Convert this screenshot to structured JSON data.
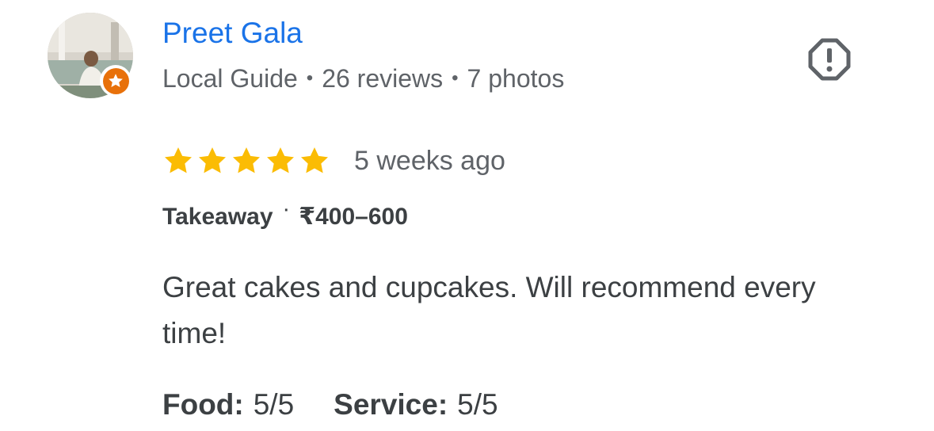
{
  "reviewer": {
    "name": "Preet Gala",
    "level": "Local Guide",
    "reviews": "26 reviews",
    "photos": "7 photos",
    "separator": "•"
  },
  "rating": {
    "stars": 5,
    "max_stars": 5,
    "time": "5 weeks ago",
    "star_color": "#fbbc04"
  },
  "service": {
    "type": "Takeaway",
    "separator": "·",
    "price": "₹400–600"
  },
  "review": {
    "text": "Great cakes and cupcakes. Will recommend every time!"
  },
  "scores": [
    {
      "label": "Food:",
      "value": "5/5"
    },
    {
      "label": "Service:",
      "value": "5/5"
    }
  ],
  "colors": {
    "name": "#1a73e8",
    "badge": "#e8710a",
    "text": "#3c4043",
    "secondary": "#5f6368"
  },
  "icons": {
    "report": "report-flag-icon",
    "badge": "local-guide-star-icon"
  }
}
